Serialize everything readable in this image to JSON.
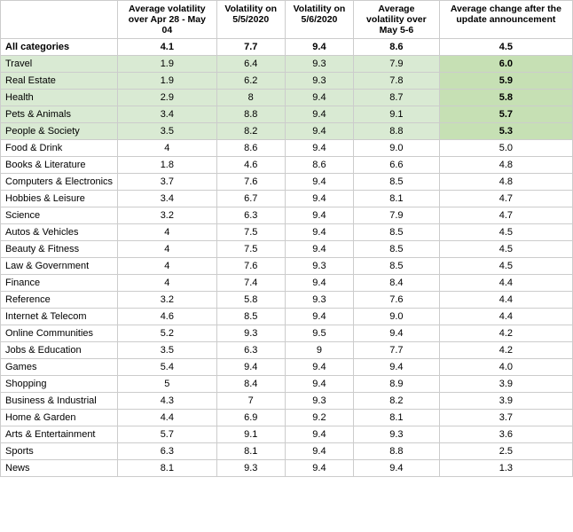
{
  "table": {
    "headers": [
      "",
      "Average volatility over Apr 28 - May 04",
      "Volatility on 5/5/2020",
      "Volatility on 5/6/2020",
      "Average volatility over May 5-6",
      "Average change after the update announcement"
    ],
    "rows": [
      {
        "name": "All categories",
        "v1": "4.1",
        "v2": "7.7",
        "v3": "9.4",
        "v4": "8.6",
        "v5": "4.5",
        "type": "bold"
      },
      {
        "name": "Travel",
        "v1": "1.9",
        "v2": "6.4",
        "v3": "9.3",
        "v4": "7.9",
        "v5": "6.0",
        "type": "green"
      },
      {
        "name": "Real Estate",
        "v1": "1.9",
        "v2": "6.2",
        "v3": "9.3",
        "v4": "7.8",
        "v5": "5.9",
        "type": "green"
      },
      {
        "name": "Health",
        "v1": "2.9",
        "v2": "8",
        "v3": "9.4",
        "v4": "8.7",
        "v5": "5.8",
        "type": "green"
      },
      {
        "name": "Pets & Animals",
        "v1": "3.4",
        "v2": "8.8",
        "v3": "9.4",
        "v4": "9.1",
        "v5": "5.7",
        "type": "green"
      },
      {
        "name": "People & Society",
        "v1": "3.5",
        "v2": "8.2",
        "v3": "9.4",
        "v4": "8.8",
        "v5": "5.3",
        "type": "green"
      },
      {
        "name": "Food & Drink",
        "v1": "4",
        "v2": "8.6",
        "v3": "9.4",
        "v4": "9.0",
        "v5": "5.0",
        "type": "normal"
      },
      {
        "name": "Books & Literature",
        "v1": "1.8",
        "v2": "4.6",
        "v3": "8.6",
        "v4": "6.6",
        "v5": "4.8",
        "type": "normal"
      },
      {
        "name": "Computers & Electronics",
        "v1": "3.7",
        "v2": "7.6",
        "v3": "9.4",
        "v4": "8.5",
        "v5": "4.8",
        "type": "normal"
      },
      {
        "name": "Hobbies & Leisure",
        "v1": "3.4",
        "v2": "6.7",
        "v3": "9.4",
        "v4": "8.1",
        "v5": "4.7",
        "type": "normal"
      },
      {
        "name": "Science",
        "v1": "3.2",
        "v2": "6.3",
        "v3": "9.4",
        "v4": "7.9",
        "v5": "4.7",
        "type": "normal"
      },
      {
        "name": "Autos & Vehicles",
        "v1": "4",
        "v2": "7.5",
        "v3": "9.4",
        "v4": "8.5",
        "v5": "4.5",
        "type": "normal"
      },
      {
        "name": "Beauty & Fitness",
        "v1": "4",
        "v2": "7.5",
        "v3": "9.4",
        "v4": "8.5",
        "v5": "4.5",
        "type": "normal"
      },
      {
        "name": "Law & Government",
        "v1": "4",
        "v2": "7.6",
        "v3": "9.3",
        "v4": "8.5",
        "v5": "4.5",
        "type": "normal"
      },
      {
        "name": "Finance",
        "v1": "4",
        "v2": "7.4",
        "v3": "9.4",
        "v4": "8.4",
        "v5": "4.4",
        "type": "normal"
      },
      {
        "name": "Reference",
        "v1": "3.2",
        "v2": "5.8",
        "v3": "9.3",
        "v4": "7.6",
        "v5": "4.4",
        "type": "normal"
      },
      {
        "name": "Internet & Telecom",
        "v1": "4.6",
        "v2": "8.5",
        "v3": "9.4",
        "v4": "9.0",
        "v5": "4.4",
        "type": "normal"
      },
      {
        "name": "Online Communities",
        "v1": "5.2",
        "v2": "9.3",
        "v3": "9.5",
        "v4": "9.4",
        "v5": "4.2",
        "type": "normal"
      },
      {
        "name": "Jobs & Education",
        "v1": "3.5",
        "v2": "6.3",
        "v3": "9",
        "v4": "7.7",
        "v5": "4.2",
        "type": "normal"
      },
      {
        "name": "Games",
        "v1": "5.4",
        "v2": "9.4",
        "v3": "9.4",
        "v4": "9.4",
        "v5": "4.0",
        "type": "normal"
      },
      {
        "name": "Shopping",
        "v1": "5",
        "v2": "8.4",
        "v3": "9.4",
        "v4": "8.9",
        "v5": "3.9",
        "type": "normal"
      },
      {
        "name": "Business & Industrial",
        "v1": "4.3",
        "v2": "7",
        "v3": "9.3",
        "v4": "8.2",
        "v5": "3.9",
        "type": "normal"
      },
      {
        "name": "Home & Garden",
        "v1": "4.4",
        "v2": "6.9",
        "v3": "9.2",
        "v4": "8.1",
        "v5": "3.7",
        "type": "normal"
      },
      {
        "name": "Arts & Entertainment",
        "v1": "5.7",
        "v2": "9.1",
        "v3": "9.4",
        "v4": "9.3",
        "v5": "3.6",
        "type": "normal"
      },
      {
        "name": "Sports",
        "v1": "6.3",
        "v2": "8.1",
        "v3": "9.4",
        "v4": "8.8",
        "v5": "2.5",
        "type": "normal"
      },
      {
        "name": "News",
        "v1": "8.1",
        "v2": "9.3",
        "v3": "9.4",
        "v4": "9.4",
        "v5": "1.3",
        "type": "normal"
      }
    ]
  }
}
